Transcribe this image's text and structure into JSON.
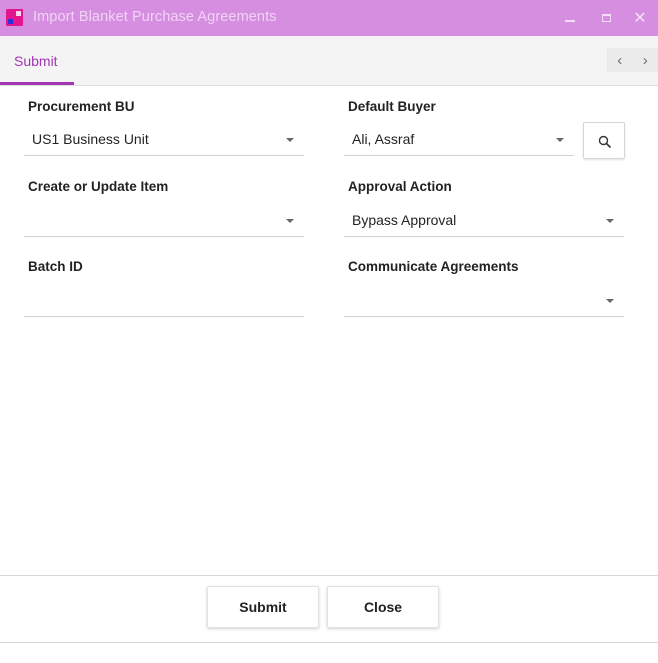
{
  "window": {
    "title": "Import Blanket Purchase Agreements",
    "minimize_icon": "minimize-icon",
    "maximize_icon": "maximize-icon",
    "close_glyph": "✕"
  },
  "tabs": [
    {
      "label": "Submit",
      "active": true
    }
  ],
  "nav": {
    "prev": "‹",
    "next": "›"
  },
  "form": {
    "procurement_bu": {
      "label": "Procurement BU",
      "value": "US1 Business Unit"
    },
    "default_buyer": {
      "label": "Default Buyer",
      "value": "Ali, Assraf",
      "search_icon": "search-icon"
    },
    "create_or_update_item": {
      "label": "Create or Update Item",
      "value": ""
    },
    "approval_action": {
      "label": "Approval Action",
      "value": "Bypass Approval"
    },
    "batch_id": {
      "label": "Batch ID",
      "value": ""
    },
    "communicate_agreements": {
      "label": "Communicate Agreements",
      "value": ""
    }
  },
  "footer": {
    "submit_label": "Submit",
    "close_label": "Close"
  },
  "colors": {
    "titlebar": "#d68ee0",
    "accent": "#a236b3"
  }
}
